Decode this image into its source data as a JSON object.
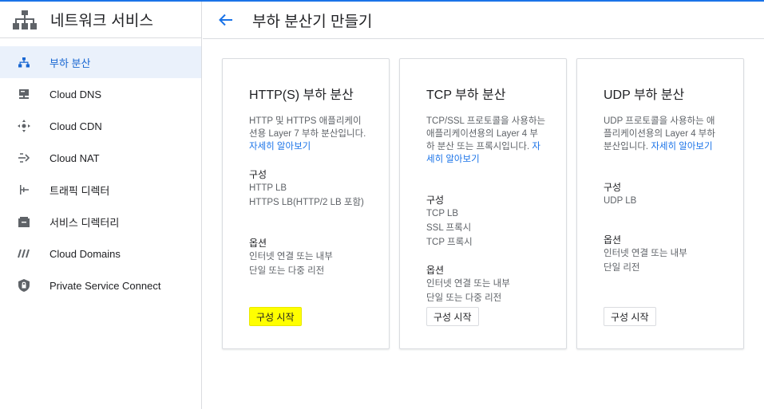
{
  "app": {
    "title": "네트워크 서비스"
  },
  "sidebar": {
    "items": [
      {
        "label": "부하 분산",
        "icon": "load-balancer-icon",
        "active": true
      },
      {
        "label": "Cloud DNS",
        "icon": "dns-icon"
      },
      {
        "label": "Cloud CDN",
        "icon": "cdn-icon"
      },
      {
        "label": "Cloud NAT",
        "icon": "nat-icon"
      },
      {
        "label": "트래픽 디렉터",
        "icon": "traffic-director-icon"
      },
      {
        "label": "서비스 디렉터리",
        "icon": "service-directory-icon"
      },
      {
        "label": "Cloud Domains",
        "icon": "domains-icon"
      },
      {
        "label": "Private Service Connect",
        "icon": "private-service-connect-icon"
      }
    ]
  },
  "header": {
    "title": "부하 분산기 만들기"
  },
  "cards": [
    {
      "title": "HTTP(S) 부하 분산",
      "desc": "HTTP 및 HTTPS 애플리케이션용 Layer 7 부하 분산입니다.",
      "link": "자세히 알아보기",
      "config_title": "구성",
      "config": [
        "HTTP LB",
        "HTTPS LB(HTTP/2 LB 포함)"
      ],
      "options_title": "옵션",
      "options": [
        "인터넷 연결 또는 내부",
        "단일 또는 다중 리전"
      ],
      "button": "구성 시작"
    },
    {
      "title": "TCP 부하 분산",
      "desc": "TCP/SSL 프로토콜을 사용하는 애플리케이션용의 Layer 4 부하 분산 또는 프록시입니다.",
      "link": "자세히 알아보기",
      "config_title": "구성",
      "config": [
        "TCP LB",
        "SSL 프록시",
        "TCP 프록시"
      ],
      "options_title": "옵션",
      "options": [
        "인터넷 연결 또는 내부",
        "단일 또는 다중 리전"
      ],
      "button": "구성 시작"
    },
    {
      "title": "UDP 부하 분산",
      "desc": "UDP 프로토콜을 사용하는 애플리케이션용의 Layer 4 부하 분산입니다.",
      "link": "자세히 알아보기",
      "config_title": "구성",
      "config": [
        "UDP LB"
      ],
      "options_title": "옵션",
      "options": [
        "인터넷 연결 또는 내부",
        "단일 리전"
      ],
      "button": "구성 시작"
    }
  ],
  "colors": {
    "accent": "#1a73e8",
    "active_bg": "#eaf1fb",
    "highlight": "#ffff00"
  }
}
